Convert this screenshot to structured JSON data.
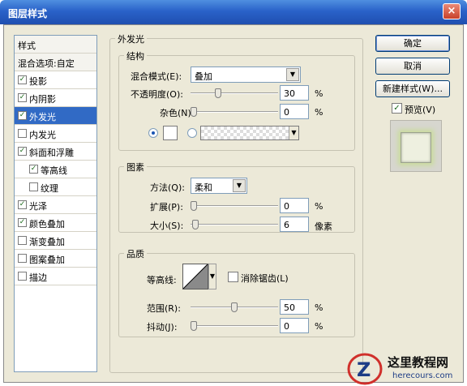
{
  "window": {
    "title": "图层样式",
    "close_glyph": "×"
  },
  "styles_panel": {
    "header": "样式",
    "blend_options": "混合选项:自定",
    "items": [
      {
        "label": "投影",
        "checked": true,
        "indent": false
      },
      {
        "label": "内阴影",
        "checked": true,
        "indent": false
      },
      {
        "label": "外发光",
        "checked": true,
        "indent": false,
        "selected": true
      },
      {
        "label": "内发光",
        "checked": false,
        "indent": false
      },
      {
        "label": "斜面和浮雕",
        "checked": true,
        "indent": false
      },
      {
        "label": "等高线",
        "checked": true,
        "indent": true
      },
      {
        "label": "纹理",
        "checked": false,
        "indent": true
      },
      {
        "label": "光泽",
        "checked": true,
        "indent": false
      },
      {
        "label": "颜色叠加",
        "checked": true,
        "indent": false
      },
      {
        "label": "渐变叠加",
        "checked": false,
        "indent": false
      },
      {
        "label": "图案叠加",
        "checked": false,
        "indent": false
      },
      {
        "label": "描边",
        "checked": false,
        "indent": false
      }
    ]
  },
  "outer_glow": {
    "title": "外发光",
    "structure": {
      "title": "结构",
      "blend_mode_label": "混合模式(E):",
      "blend_mode_value": "叠加",
      "opacity_label": "不透明度(O):",
      "opacity_value": "30",
      "opacity_fraction": 0.3,
      "noise_label": "杂色(N):",
      "noise_value": "0",
      "noise_fraction": 0.0,
      "percent": "%"
    },
    "elements": {
      "title": "图素",
      "technique_label": "方法(Q):",
      "technique_value": "柔和",
      "spread_label": "扩展(P):",
      "spread_value": "0",
      "spread_fraction": 0.0,
      "size_label": "大小(S):",
      "size_value": "6",
      "size_fraction": 0.024,
      "percent": "%",
      "pixels": "像素"
    },
    "quality": {
      "title": "品质",
      "contour_label": "等高线:",
      "anti_alias_label": "消除锯齿(L)",
      "anti_alias_checked": false,
      "range_label": "范围(R):",
      "range_value": "50",
      "range_fraction": 0.5,
      "jitter_label": "抖动(J):",
      "jitter_value": "0",
      "jitter_fraction": 0.0,
      "percent": "%"
    }
  },
  "buttons": {
    "ok": "确定",
    "cancel": "取消",
    "new_style": "新建样式(W)...",
    "preview_label": "预览(V)",
    "preview_checked": true
  },
  "watermark": {
    "title": "这里教程网",
    "url": "herecours.com"
  },
  "icons": {
    "dropdown": "▼",
    "check": "✓"
  },
  "colors": {
    "accent": "#316ac5",
    "titlebar": "#2a62c9",
    "glow": "#c9dc9a"
  }
}
